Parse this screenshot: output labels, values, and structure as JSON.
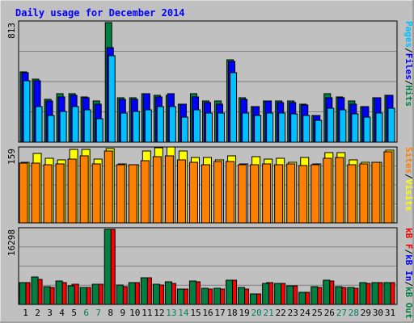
{
  "chart_data": {
    "type": "bar",
    "title": "Daily usage for December 2014",
    "categories": [
      "1",
      "2",
      "3",
      "4",
      "5",
      "6",
      "7",
      "8",
      "9",
      "10",
      "11",
      "12",
      "13",
      "14",
      "15",
      "16",
      "17",
      "18",
      "19",
      "20",
      "21",
      "22",
      "23",
      "24",
      "25",
      "26",
      "27",
      "28",
      "29",
      "30",
      "31"
    ],
    "weekend_days": [
      "6",
      "7",
      "13",
      "14",
      "20",
      "21",
      "27",
      "28"
    ],
    "panels": [
      {
        "max_label": "813",
        "ylim": [
          0,
          813
        ],
        "legend": [
          "Pages",
          "/",
          "Files",
          "/",
          "Hits"
        ],
        "series": [
          {
            "name": "Hits",
            "color": "#008040",
            "values": [
              480,
              430,
              290,
              330,
              330,
              310,
              280,
              813,
              300,
              300,
              330,
              320,
              320,
              260,
              330,
              280,
              280,
              560,
              300,
              240,
              280,
              280,
              280,
              260,
              180,
              330,
              310,
              280,
              240,
              300,
              320
            ]
          },
          {
            "name": "Files",
            "color": "#0000ff",
            "values": [
              470,
              420,
              280,
              310,
              320,
              300,
              260,
              640,
              290,
              290,
              330,
              310,
              330,
              260,
              310,
              270,
              260,
              550,
              290,
              240,
              280,
              270,
              270,
              250,
              180,
              300,
              300,
              260,
              240,
              300,
              320
            ]
          },
          {
            "name": "Pages",
            "color": "#00c0ff",
            "values": [
              420,
              240,
              180,
              210,
              240,
              220,
              160,
              590,
              200,
              210,
              220,
              240,
              240,
              170,
              220,
              200,
              200,
              470,
              200,
              180,
              200,
              200,
              190,
              180,
              150,
              230,
              220,
              190,
              170,
              200,
              230
            ]
          }
        ]
      },
      {
        "max_label": "159",
        "ylim": [
          0,
          159
        ],
        "legend": [
          "Sites",
          "/",
          "Visits"
        ],
        "series": [
          {
            "name": "Visits",
            "color": "#ffff00",
            "values": [
              130,
              148,
              138,
              134,
              157,
              157,
              136,
              159,
              127,
              125,
              154,
              160,
              162,
              153,
              140,
              140,
              134,
              143,
              126,
              142,
              137,
              138,
              129,
              140,
              126,
              150,
              150,
              135,
              130,
              129,
              156
            ]
          },
          {
            "name": "Sites",
            "color": "#ff8000",
            "values": [
              128,
              128,
              125,
              126,
              137,
              144,
              127,
              153,
              125,
              125,
              133,
              141,
              143,
              134,
              129,
              124,
              131,
              131,
              125,
              125,
              127,
              124,
              126,
              123,
              125,
              138,
              140,
              124,
              127,
              129,
              152
            ]
          }
        ]
      },
      {
        "max_label": "16298",
        "ylim": [
          0,
          16298
        ],
        "legend": [
          "kB F",
          "/",
          "kB In",
          "/",
          "kB Out"
        ],
        "series": [
          {
            "name": "kB F",
            "color": "#ff0000",
            "values": [
              4800,
              5500,
              3700,
              4700,
              4300,
              3600,
              4400,
              16298,
              3900,
              4800,
              5800,
              4200,
              4500,
              3300,
              4900,
              3400,
              3400,
              5300,
              3400,
              2200,
              4700,
              4500,
              4100,
              2600,
              3700,
              5100,
              3700,
              3500,
              4600,
              4800,
              4800
            ]
          },
          {
            "name": "kB Out",
            "color": "#008040",
            "values": [
              4800,
              6000,
              3900,
              5000,
              4100,
              3700,
              4400,
              16298,
              4200,
              4800,
              5800,
              4300,
              4900,
              3300,
              5000,
              3500,
              3500,
              5300,
              3600,
              2300,
              4500,
              4500,
              4100,
              2700,
              3800,
              5300,
              3900,
              3600,
              4700,
              4800,
              4800
            ]
          }
        ]
      }
    ]
  },
  "colors": {
    "background": "#c0c0c0",
    "border": "#000000",
    "gridline": "#808080",
    "axis_text": "#000000",
    "weekend_text": "#00805c",
    "title_color": "#0000ff"
  }
}
